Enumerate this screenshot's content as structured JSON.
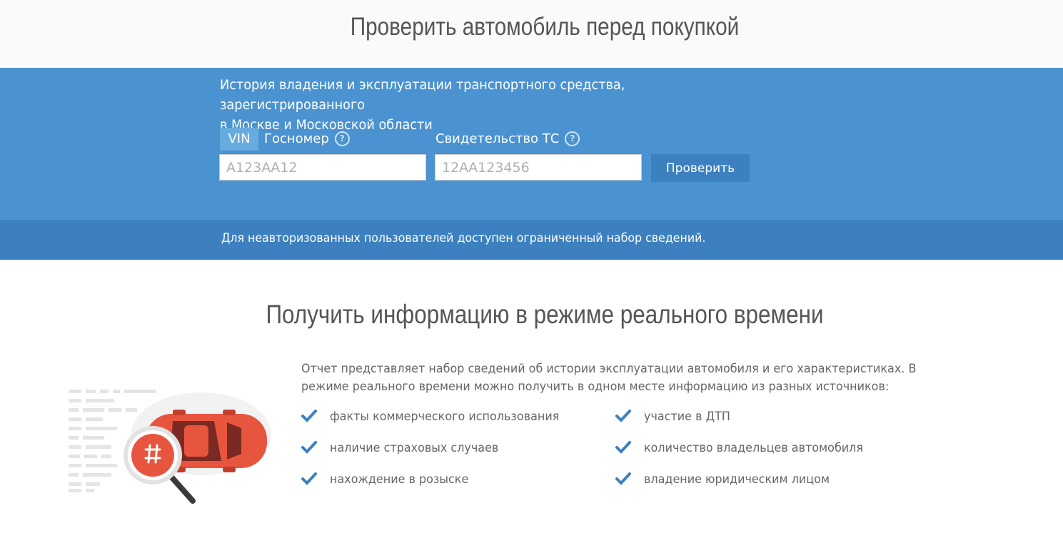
{
  "header": {
    "title": "Проверить автомобиль перед покупкой"
  },
  "hero": {
    "description_line1": "История владения и эксплуатации транспортного средства, зарегистрированного",
    "description_line2": "в Москве и Московской области",
    "tabs": {
      "vin_label": "VIN",
      "plate_label": "Госномер",
      "certificate_label": "Свидетельство ТС"
    },
    "help_icon_glyph": "?",
    "plate_placeholder": "А123АА12",
    "certificate_placeholder": "12АА123456",
    "check_button_label": "Проверить"
  },
  "notice": {
    "text": "Для неавторизованных пользователей доступен ограниченный набор сведений."
  },
  "realtime": {
    "title": "Получить информацию в режиме реального времени",
    "intro_line1": "Отчет представляет набор сведений об истории эксплуатации автомобиля и его характеристиках. В",
    "intro_line2": "режиме реального времени можно получить в одном месте информацию из разных источников:",
    "features": [
      "факты коммерческого использования",
      "участие в ДТП",
      "наличие страховых случаев",
      "количество владельцев автомобиля",
      "нахождение в розыске",
      "владение юридическим лицом"
    ]
  },
  "colors": {
    "hero_blue": "#4a93d0",
    "notice_blue": "#3c80bf",
    "check_blue": "#3d80bf",
    "car_red": "#e8553f"
  },
  "icons": [
    "help-icon",
    "check-icon",
    "car-illustration",
    "magnifier-icon"
  ]
}
